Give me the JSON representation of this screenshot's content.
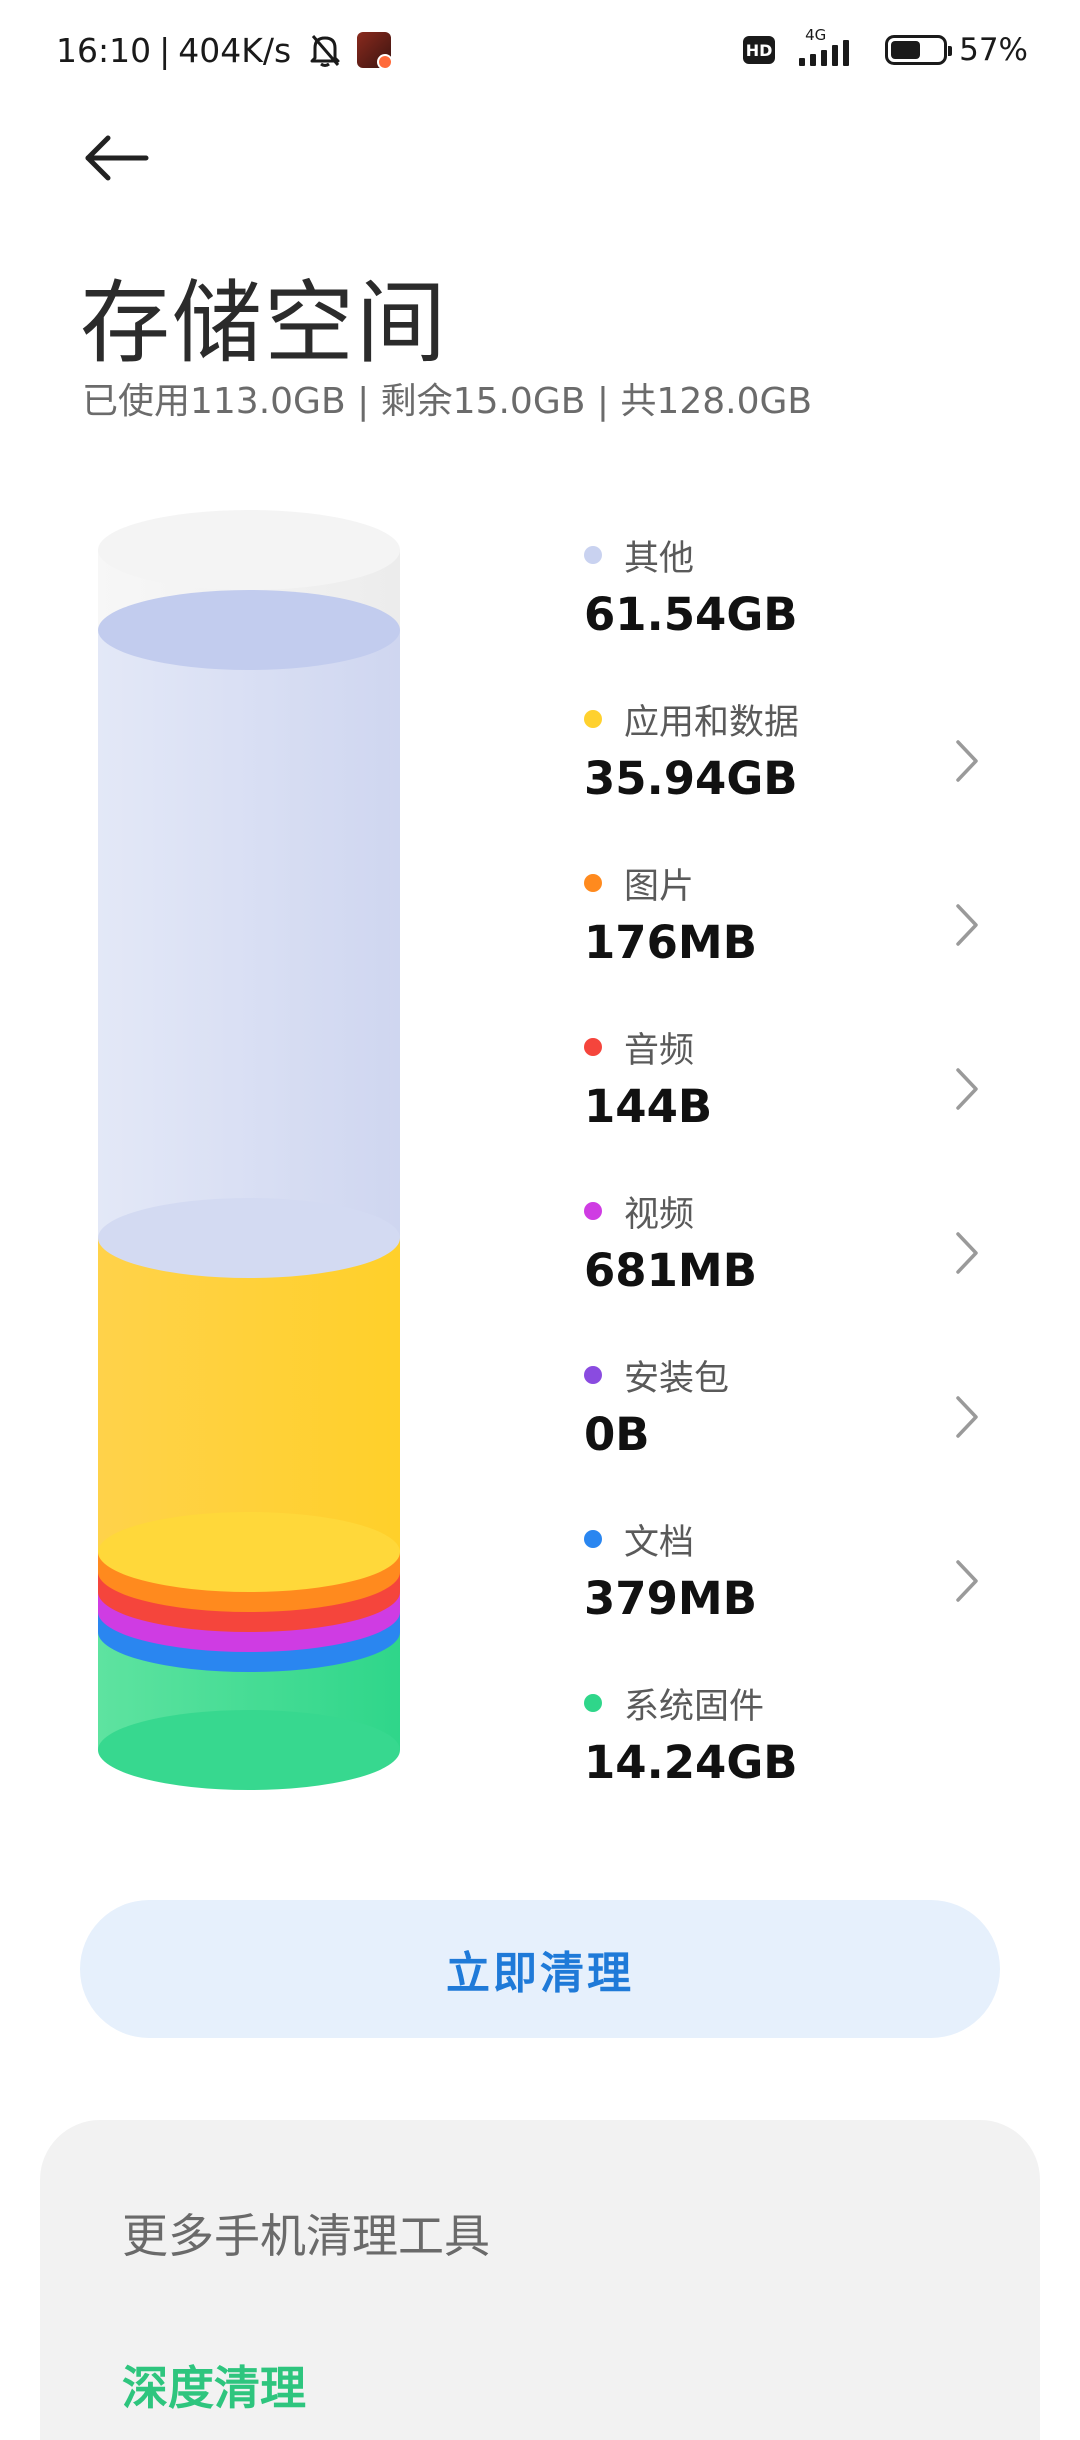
{
  "status_bar": {
    "time": "16:10",
    "separator": "|",
    "net_speed": "404K/s",
    "hd_badge": "HD",
    "network": "4G",
    "battery_percent": 57,
    "battery_text": "57%"
  },
  "header": {
    "title": "存储空间",
    "summary": "已使用113.0GB | 剩余15.0GB | 共128.0GB"
  },
  "icons": {
    "back": "back-arrow-icon",
    "mute": "bell-off-icon",
    "chevron": "chevron-right-icon"
  },
  "storage": {
    "categories": [
      {
        "label": "其他",
        "value": "61.54GB",
        "color": "#c9d2f0",
        "has_chevron": false
      },
      {
        "label": "应用和数据",
        "value": "35.94GB",
        "color": "#ffd12e",
        "has_chevron": true
      },
      {
        "label": "图片",
        "value": "176MB",
        "color": "#ff8a1e",
        "has_chevron": true
      },
      {
        "label": "音频",
        "value": "144B",
        "color": "#f5453c",
        "has_chevron": true
      },
      {
        "label": "视频",
        "value": "681MB",
        "color": "#cf3ce3",
        "has_chevron": true
      },
      {
        "label": "安装包",
        "value": "0B",
        "color": "#8a4be0",
        "has_chevron": true
      },
      {
        "label": "文档",
        "value": "379MB",
        "color": "#2a86f0",
        "has_chevron": true
      },
      {
        "label": "系统固件",
        "value": "14.24GB",
        "color": "#2fd68a",
        "has_chevron": false
      }
    ]
  },
  "actions": {
    "clean_now": "立即清理"
  },
  "tools": {
    "title": "更多手机清理工具",
    "deep_clean": "深度清理"
  }
}
